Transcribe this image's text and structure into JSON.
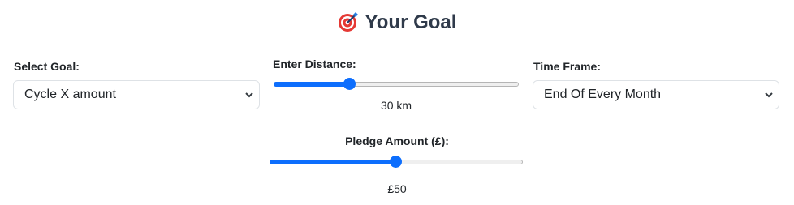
{
  "header": {
    "title": "Your Goal",
    "icon": "target-icon"
  },
  "goal_select": {
    "label": "Select Goal:",
    "selected": "Cycle X amount"
  },
  "distance": {
    "label": "Enter Distance:",
    "value_text": "30 km",
    "fraction": 0.3
  },
  "time_frame": {
    "label": "Time Frame:",
    "selected": "End Of Every Month"
  },
  "pledge": {
    "label": "Pledge Amount (£):",
    "value_text": "£50",
    "fraction": 0.5
  },
  "colors": {
    "accent": "#0d6efd",
    "title": "#2f3a4a",
    "border": "#dee2e6"
  }
}
